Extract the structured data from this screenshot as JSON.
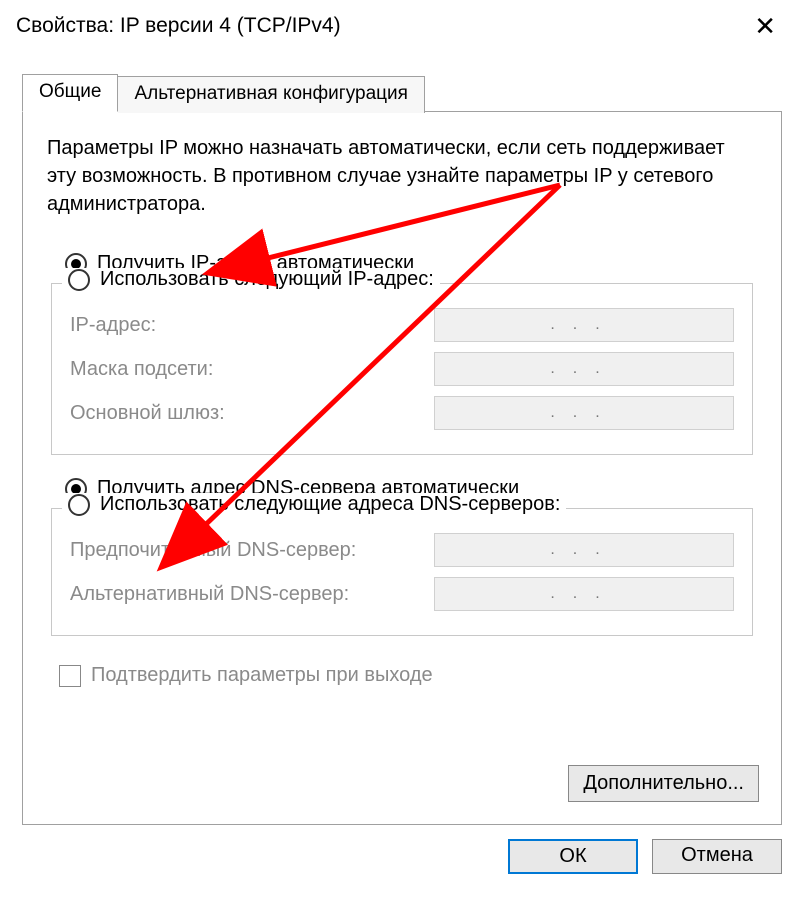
{
  "window": {
    "title": "Свойства: IP версии 4 (TCP/IPv4)"
  },
  "tabs": {
    "general": "Общие",
    "alternate": "Альтернативная конфигурация"
  },
  "description": "Параметры IP можно назначать автоматически, если сеть поддерживает эту возможность. В противном случае узнайте параметры IP у сетевого администратора.",
  "ip": {
    "auto_label": "Получить IP-адрес автоматически",
    "manual_label": "Использовать следующий IP-адрес:",
    "fields": {
      "ip_address": "IP-адрес:",
      "subnet_mask": "Маска подсети:",
      "default_gateway": "Основной шлюз:"
    }
  },
  "dns": {
    "auto_label": "Получить адрес DNS-сервера автоматически",
    "manual_label": "Использовать следующие адреса DNS-серверов:",
    "fields": {
      "preferred": "Предпочитаемый DNS-сервер:",
      "alternate": "Альтернативный DNS-сервер:"
    }
  },
  "validate_label": "Подтвердить параметры при выходе",
  "advanced_label": "Дополнительно...",
  "buttons": {
    "ok": "ОК",
    "cancel": "Отмена"
  },
  "ip_placeholder": "...",
  "colors": {
    "arrow": "#ff0000",
    "accent": "#0078d4"
  }
}
